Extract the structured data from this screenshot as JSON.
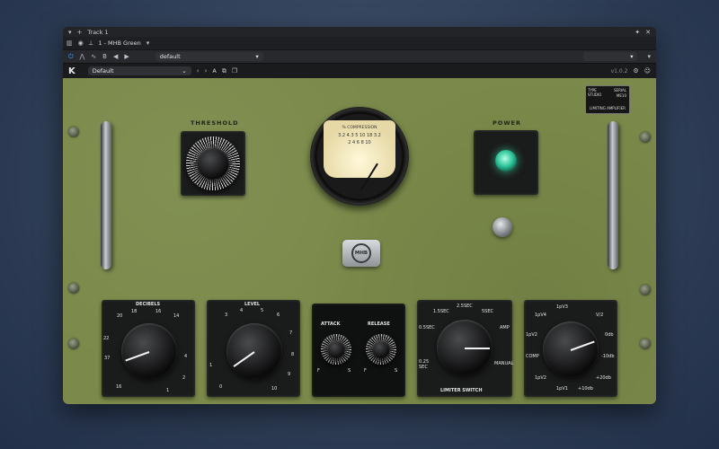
{
  "titlebar": {
    "track": "Track 1"
  },
  "track_bar": {
    "track_name": "1 - MHB Green"
  },
  "toolbar": {
    "preset_default": "default"
  },
  "plugin_header": {
    "preset_name": "Default",
    "version": "v1.0.2",
    "a_label": "A"
  },
  "panel": {
    "threshold_label": "THRESHOLD",
    "power_label": "POWER",
    "meter_label": "% COMPRESSION",
    "meter_numbers": "3.2 4.3 5 10 18 3.2",
    "meter_sub": "2 4 6 8 10",
    "nameplate_lines": [
      "TYPE",
      "STUDIO",
      "SERIAL",
      "ME10",
      "LIMITING AMPLIFIER"
    ],
    "badge_text": "MHB",
    "knobs": {
      "decibels_label": "DECIBELS",
      "level_label": "LEVEL",
      "attack_label": "ATTACK",
      "release_label": "RELEASE",
      "limiter_label": "LIMITER SWITCH",
      "decibels_scale": [
        "20",
        "18",
        "16",
        "14",
        "22",
        "37",
        "4",
        "2",
        "1",
        "16"
      ],
      "level_scale": [
        "3",
        "4",
        "5",
        "6",
        "7",
        "8",
        "9",
        "10",
        "0",
        "1"
      ],
      "attack_scale": [
        "F",
        "S"
      ],
      "release_scale": [
        "F",
        "S"
      ],
      "limiter_scale": [
        "1.5SEC",
        "2.5SEC",
        "5SEC",
        "0.5SEC",
        "AMP",
        "0.25 SEC",
        "MANUAL"
      ],
      "right_scale": [
        "1pV4",
        "1pV3",
        "V/2",
        "1pV2",
        "0db",
        "COMP",
        "-10db",
        "1pV2",
        "1pV1",
        "+10db",
        "+20db"
      ]
    }
  },
  "colors": {
    "panel": "#7b8a4a",
    "accent": "#4aa3ff"
  }
}
